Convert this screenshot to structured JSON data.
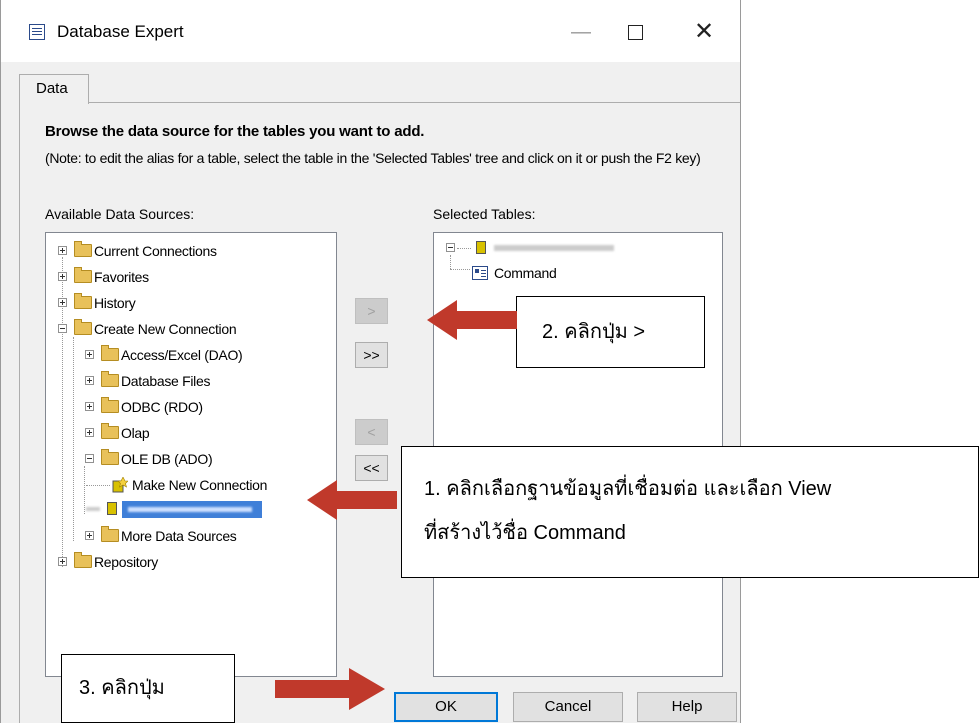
{
  "window": {
    "title": "Database Expert",
    "minimize": "—",
    "close": "✕"
  },
  "tabs": [
    {
      "label": "Data"
    }
  ],
  "main": {
    "heading": "Browse the data source for the tables you want to add.",
    "note": "(Note: to edit the alias for a table, select the table in the 'Selected Tables' tree and click on it or push the F2 key)",
    "available_label": "Available Data Sources:",
    "selected_label": "Selected Tables:"
  },
  "available_tree": {
    "items": [
      {
        "label": "Current Connections"
      },
      {
        "label": "Favorites"
      },
      {
        "label": "History"
      },
      {
        "label": "Create New Connection"
      },
      {
        "label": "Access/Excel (DAO)"
      },
      {
        "label": "Database Files"
      },
      {
        "label": "ODBC (RDO)"
      },
      {
        "label": "Olap"
      },
      {
        "label": "OLE DB (ADO)"
      },
      {
        "label": "Make New Connection"
      },
      {
        "label": "More Data Sources"
      },
      {
        "label": "Repository"
      }
    ]
  },
  "selected_tree": {
    "items": [
      {
        "label": "Command"
      }
    ]
  },
  "move_buttons": {
    "add": ">",
    "add_all": ">>",
    "remove": "<",
    "remove_all": "<<"
  },
  "footer": {
    "ok": "OK",
    "cancel": "Cancel",
    "help": "Help"
  },
  "annotations": {
    "step1_line1": "1. คลิกเลือกฐานข้อมูลที่เชื่อมต่อ และเลือก View",
    "step1_line2": "ที่สร้างไว้ชื่อ Command",
    "step2": "2. คลิกปุ่ม >",
    "step3": "3. คลิกปุ่ม",
    "arrow_color": "#c0392b"
  }
}
